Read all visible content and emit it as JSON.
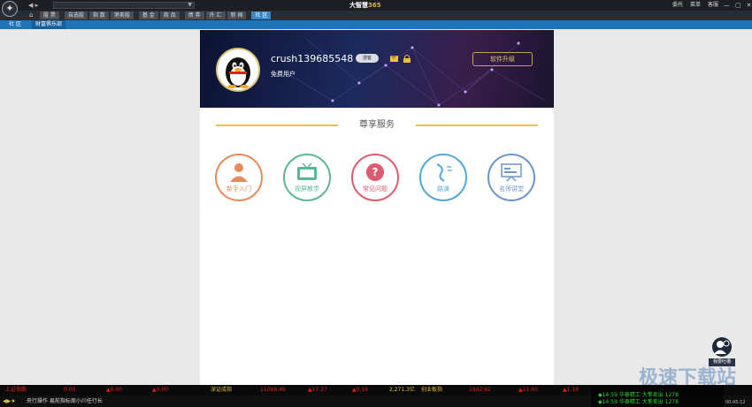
{
  "titlebar": {
    "app_title_cn": "大智慧",
    "app_title_num": "365",
    "links": [
      "委托",
      "菜单",
      "客服"
    ],
    "controls": [
      "—",
      "▢",
      "✕"
    ]
  },
  "menu": {
    "items": [
      "股 票",
      "自选股",
      "指 数",
      "港美股",
      "基 金",
      "商 品",
      "债 券",
      "外 汇",
      "新 闻",
      "社 区"
    ],
    "active_index": 9
  },
  "tabs": [
    "社 区",
    "财富俱乐部"
  ],
  "profile": {
    "username": "crush139685548",
    "vip_badge": "游客",
    "account_type": "免费用户",
    "upgrade_label": "软件升级"
  },
  "section": {
    "title": "尊享服务"
  },
  "services": [
    {
      "label": "新手入门",
      "icon": "user-icon",
      "color": "#e98a5b"
    },
    {
      "label": "视屏教学",
      "icon": "tv-icon",
      "color": "#5bb59a"
    },
    {
      "label": "常见问题",
      "icon": "question-icon",
      "color": "#dc5b6e"
    },
    {
      "label": "路演",
      "icon": "roadshow-icon",
      "color": "#4fa8d8"
    },
    {
      "label": "名师讲堂",
      "icon": "lecture-icon",
      "color": "#6b96c8"
    }
  ],
  "ticker": {
    "items": [
      "上证指数",
      "0.00",
      "▲0.00",
      "▲0.00",
      "深证成指",
      "11068.49",
      "▲17.37",
      "▲0.16",
      "2,271.3亿",
      "创业板指",
      "1842.92",
      "▲21.60",
      "▲1.19"
    ]
  },
  "scroll": {
    "text": "央行操作 易前指标周小川任行长"
  },
  "news": [
    "◆14:59  华泰精工  大笔卖出 1278",
    "◆14:59  华泰精工  大笔卖出 1278"
  ],
  "clock": "00:45:12",
  "watermark": "极速下载站",
  "help_label": "我要吐槽"
}
